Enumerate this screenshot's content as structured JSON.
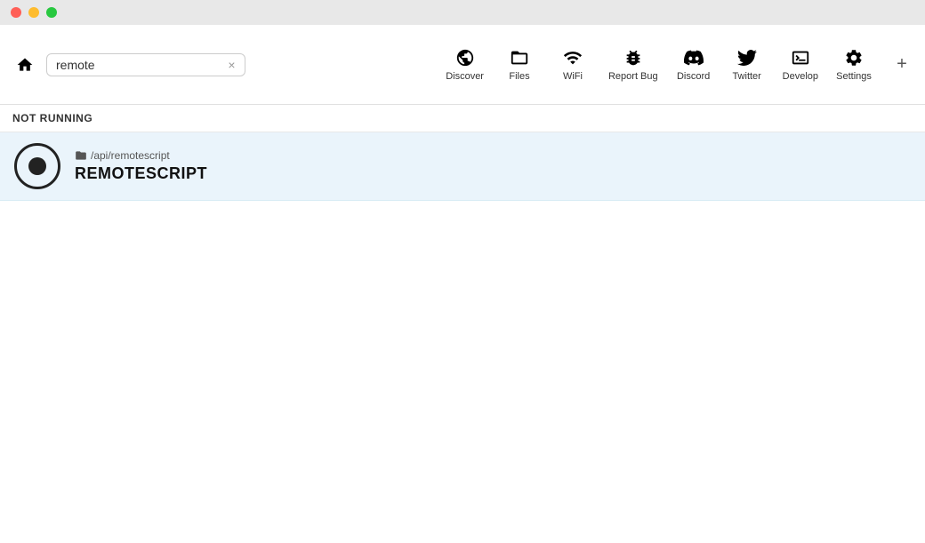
{
  "titlebar": {
    "traffic": [
      "close",
      "minimize",
      "maximize"
    ]
  },
  "navbar": {
    "home_label": "home",
    "search_value": "remote",
    "clear_label": "×",
    "add_label": "+",
    "icons": [
      {
        "id": "discover",
        "label": "Discover",
        "icon": "globe"
      },
      {
        "id": "files",
        "label": "Files",
        "icon": "files"
      },
      {
        "id": "wifi",
        "label": "WiFi",
        "icon": "wifi"
      },
      {
        "id": "report-bug",
        "label": "Report Bug",
        "icon": "bug"
      },
      {
        "id": "discord",
        "label": "Discord",
        "icon": "discord"
      },
      {
        "id": "twitter",
        "label": "Twitter",
        "icon": "twitter"
      },
      {
        "id": "develop",
        "label": "Develop",
        "icon": "develop"
      },
      {
        "id": "settings",
        "label": "Settings",
        "icon": "settings"
      }
    ]
  },
  "status": {
    "label": "NOT RUNNING"
  },
  "script_item": {
    "path": "/api/remotescript",
    "name": "REMOTESCRIPT"
  }
}
